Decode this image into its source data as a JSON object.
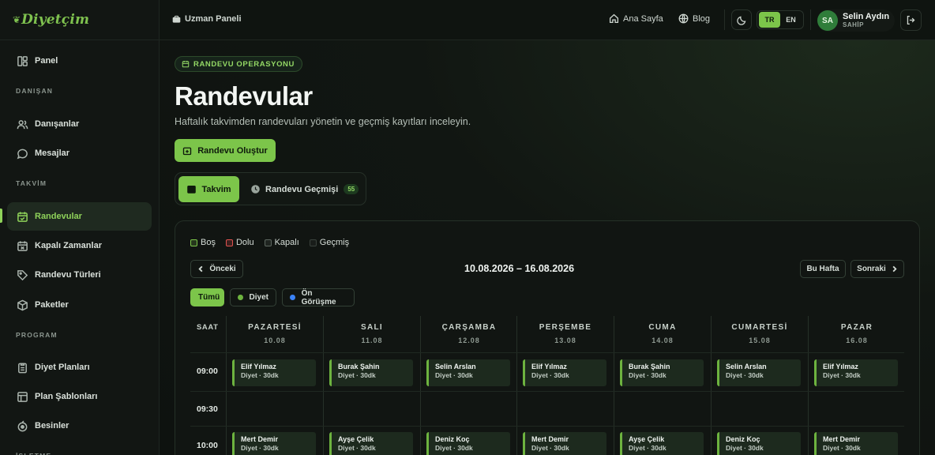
{
  "brand": {
    "name": "Diyetçim"
  },
  "sidebar": {
    "sections": [
      "DANIŞAN",
      "TAKVİM",
      "PROGRAM",
      "İŞLETME"
    ],
    "items": [
      {
        "label": "Panel",
        "icon": "layout-icon"
      },
      {
        "label": "Danışanlar",
        "icon": "users-icon"
      },
      {
        "label": "Mesajlar",
        "icon": "message-icon"
      },
      {
        "label": "Randevular",
        "icon": "calendar-check-icon",
        "active": true
      },
      {
        "label": "Kapalı Zamanlar",
        "icon": "calendar-x-icon"
      },
      {
        "label": "Randevu Türleri",
        "icon": "tag-icon"
      },
      {
        "label": "Paketler",
        "icon": "package-icon"
      },
      {
        "label": "Diyet Planları",
        "icon": "clipboard-icon"
      },
      {
        "label": "Plan Şablonları",
        "icon": "template-icon"
      },
      {
        "label": "Besinler",
        "icon": "apple-icon"
      }
    ]
  },
  "topbar": {
    "breadcrumb": "Uzman Paneli",
    "home": "Ana Sayfa",
    "blog": "Blog",
    "lang_tr": "TR",
    "lang_en": "EN",
    "user_initials": "SA",
    "user_name": "Selin Aydın",
    "user_role": "SAHİP"
  },
  "header": {
    "pill": "RANDEVU OPERASYONU",
    "title": "Randevular",
    "subtitle": "Haftalık takvimden randevuları yönetin ve geçmiş kayıtları inceleyin.",
    "create_button": "Randevu Oluştur"
  },
  "tabs": {
    "calendar": "Takvim",
    "history": "Randevu Geçmişi",
    "history_count": "55"
  },
  "calendar": {
    "legend": [
      {
        "label": "Boş",
        "color": "#7cc54a"
      },
      {
        "label": "Dolu",
        "color": "#e0524f"
      },
      {
        "label": "Kapalı",
        "color": "#5d6760"
      },
      {
        "label": "Geçmiş",
        "color": "#3a423c"
      }
    ],
    "prev": "Önceki",
    "range": "10.08.2026 – 16.08.2026",
    "this_week": "Bu Hafta",
    "next": "Sonraki",
    "filters": [
      {
        "label": "Tümü",
        "on": true
      },
      {
        "label": "Diyet",
        "dot": "#6db33f"
      },
      {
        "label": "Ön Görüşme",
        "dot": "#3b82f6"
      }
    ],
    "saat": "SAAT",
    "days": [
      {
        "name": "PAZARTESİ",
        "date": "10.08"
      },
      {
        "name": "SALI",
        "date": "11.08"
      },
      {
        "name": "ÇARŞAMBA",
        "date": "12.08"
      },
      {
        "name": "PERŞEMBE",
        "date": "13.08"
      },
      {
        "name": "CUMA",
        "date": "14.08"
      },
      {
        "name": "CUMARTESİ",
        "date": "15.08"
      },
      {
        "name": "PAZAR",
        "date": "16.08"
      }
    ],
    "times": [
      "09:00",
      "09:30",
      "10:00"
    ],
    "appointments": [
      {
        "time": 0,
        "names": [
          "Elif Yılmaz",
          "Burak Şahin",
          "Selin Arslan",
          "Elif Yılmaz",
          "Burak Şahin",
          "Selin Arslan",
          "Elif Yılmaz"
        ]
      },
      {
        "time": 2,
        "names": [
          "Mert Demir",
          "Ayşe Çelik",
          "Deniz Koç",
          "Mert Demir",
          "Ayşe Çelik",
          "Deniz Koç",
          "Mert Demir"
        ]
      }
    ],
    "appt_detail": "Diyet · 30dk"
  }
}
